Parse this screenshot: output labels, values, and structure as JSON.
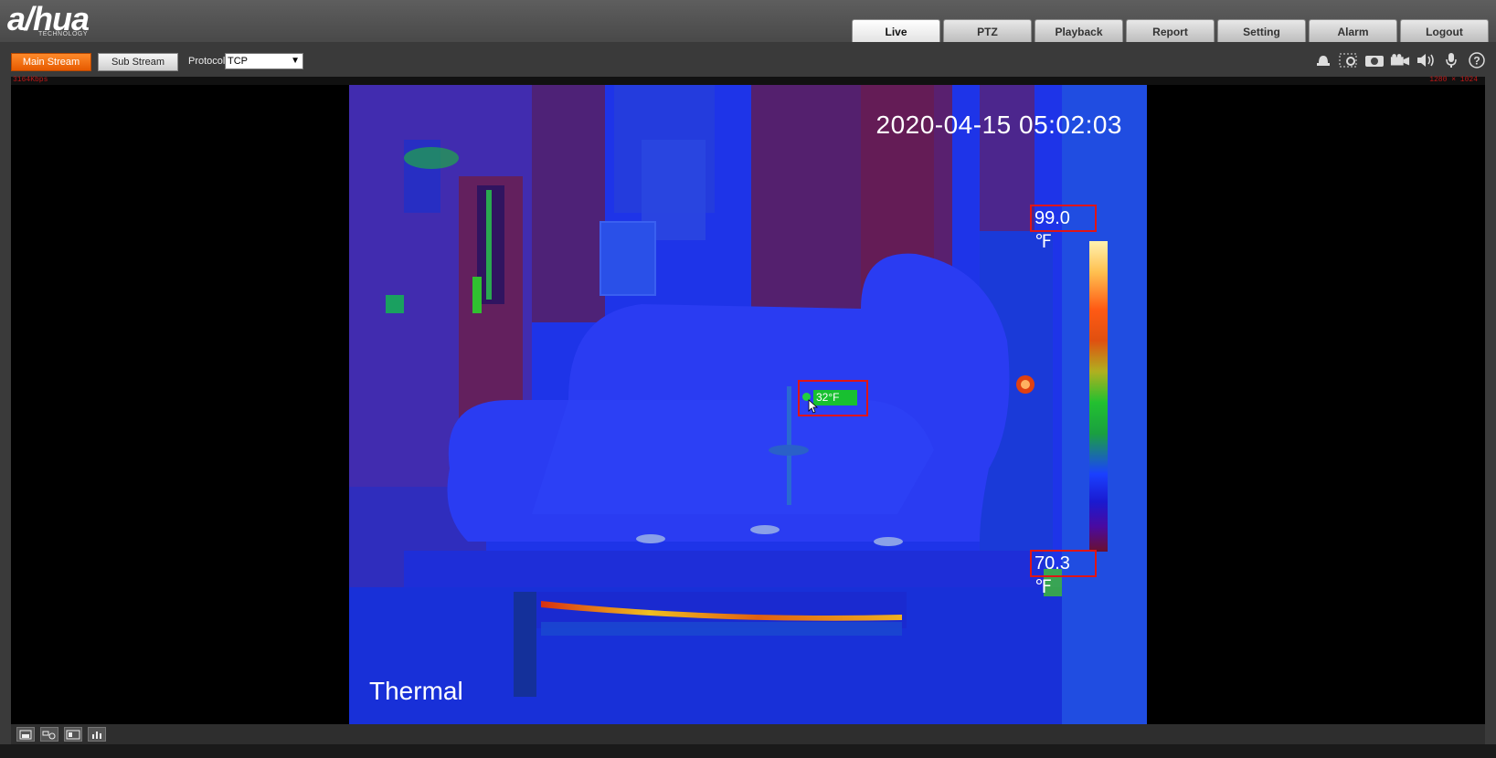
{
  "brand": {
    "logo_text": "a/hua",
    "logo_subtext": "TECHNOLOGY"
  },
  "nav": {
    "tabs": [
      {
        "label": "Live",
        "active": true
      },
      {
        "label": "PTZ"
      },
      {
        "label": "Playback"
      },
      {
        "label": "Report"
      },
      {
        "label": "Setting"
      },
      {
        "label": "Alarm"
      },
      {
        "label": "Logout"
      }
    ]
  },
  "toolbar": {
    "main_stream_label": "Main Stream",
    "sub_stream_label": "Sub Stream",
    "protocol_label": "Protocol",
    "protocol_value": "TCP",
    "icons": [
      "alarm-output-icon",
      "digital-zoom-icon",
      "snapshot-icon",
      "record-icon",
      "audio-icon",
      "microphone-icon",
      "help-icon"
    ]
  },
  "stats": {
    "bitrate": "3164Kbps",
    "resolution": "1280 × 1024"
  },
  "video": {
    "timestamp": "2020-04-15 05:02:03",
    "channel_name": "Thermal",
    "max_temp": "99.0 ℉",
    "min_temp": "70.3 ℉",
    "spot_temp": "32°F"
  },
  "bottom_toolbar": {
    "icons": [
      "window-mode-icon",
      "rule-config-icon",
      "image-adjust-icon",
      "histogram-icon"
    ]
  },
  "colors": {
    "accent": "#f07010",
    "alert_box": "#e01515",
    "spot_label": "#18c030"
  }
}
